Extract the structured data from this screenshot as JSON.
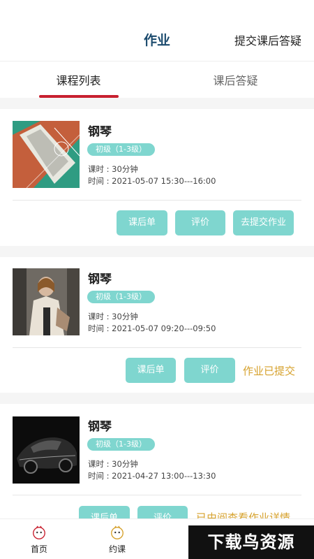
{
  "header": {
    "title": "作业",
    "action": "提交课后答疑"
  },
  "tabs": [
    {
      "label": "课程列表"
    },
    {
      "label": "课后答疑"
    }
  ],
  "courses": [
    {
      "name": "钢琴",
      "level": "初级（1-3级）",
      "duration": "课时 : 30分钟",
      "time": "时间 : 2021-05-07 15:30---16:00",
      "buttons": [
        "课后单",
        "评价",
        "去提交作业"
      ],
      "status": ""
    },
    {
      "name": "钢琴",
      "level": "初级（1-3级）",
      "duration": "课时 : 30分钟",
      "time": "时间 : 2021-05-07 09:20---09:50",
      "buttons": [
        "课后单",
        "评价"
      ],
      "status": "作业已提交"
    },
    {
      "name": "钢琴",
      "level": "初级（1-3级）",
      "duration": "课时 : 30分钟",
      "time": "时间 : 2021-04-27 13:00---13:30",
      "buttons": [
        "课后单",
        "评价"
      ],
      "status": "已由阅查看作业详情"
    }
  ],
  "nav": [
    {
      "label": "首页"
    },
    {
      "label": "约课"
    }
  ],
  "watermark": "下载鸟资源",
  "colors": {
    "accent": "#7fd6cf",
    "tab_indicator": "#c8202f",
    "status": "#d6a12c",
    "title": "#1c4b6e"
  }
}
